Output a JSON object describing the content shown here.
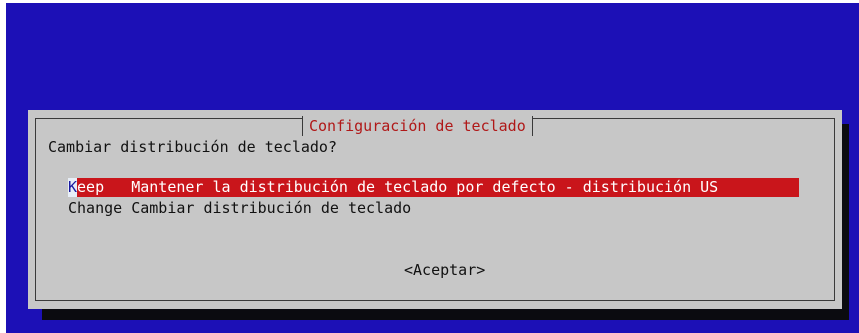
{
  "dialog": {
    "title": "Configuración de teclado",
    "question": "Cambiar distribución de teclado?",
    "options": [
      {
        "key_first": "K",
        "key_rest": "eep",
        "description": "Mantener la distribución de teclado por defecto - distribución US"
      },
      {
        "key": "Change",
        "description": "Cambiar distribución de teclado"
      }
    ],
    "accept_label": "<Aceptar>"
  },
  "colors": {
    "background": "#1c10b6",
    "dialog": "#c7c7c7",
    "title_text": "#b01818",
    "selection": "#c9151b"
  }
}
